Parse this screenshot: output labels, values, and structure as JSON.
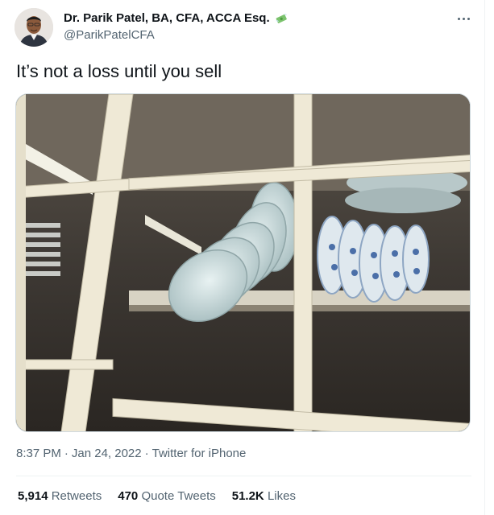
{
  "author": {
    "name": "Dr. Parik Patel, BA, CFA, ACCA Esq.",
    "handle": "@ParikPatelCFA",
    "name_emoji_icon": "money-with-wings-icon"
  },
  "tweet": {
    "text": "It’s not a loss until you sell",
    "time": "8:37 PM",
    "date": "Jan 24, 2022",
    "source": "Twitter for iPhone",
    "separator": "·"
  },
  "stats": {
    "retweets_count": "5,914",
    "retweets_label": "Retweets",
    "quotes_count": "470",
    "quotes_label": "Quote Tweets",
    "likes_count": "51.2K",
    "likes_label": "Likes"
  },
  "colors": {
    "text_primary": "#0f1419",
    "text_secondary": "#536471",
    "border": "#eff3f4"
  }
}
